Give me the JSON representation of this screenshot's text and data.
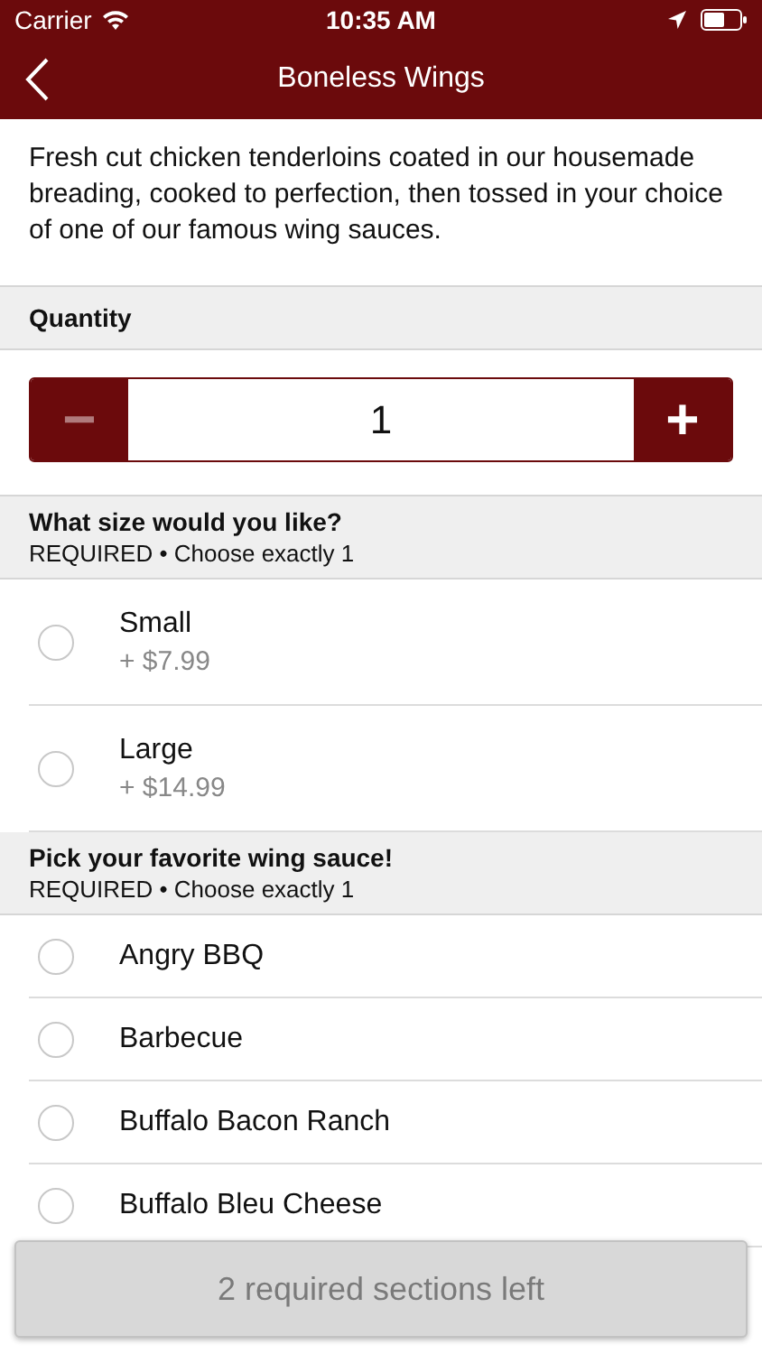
{
  "status_bar": {
    "carrier": "Carrier",
    "time": "10:35 AM"
  },
  "nav": {
    "title": "Boneless Wings"
  },
  "description": "Fresh cut chicken tenderloins coated in our housemade breading, cooked to perfection, then tossed in your choice of one of our famous wing sauces.",
  "quantity": {
    "title": "Quantity",
    "value": "1",
    "decrement": {
      "label": "−",
      "disabled": true
    },
    "increment": {
      "label": "+",
      "disabled": false
    }
  },
  "sections": [
    {
      "title": "What size would you like?",
      "subtitle": "REQUIRED • Choose exactly 1",
      "options": [
        {
          "label": "Small",
          "price": "+ $7.99",
          "selected": false
        },
        {
          "label": "Large",
          "price": "+ $14.99",
          "selected": false
        }
      ]
    },
    {
      "title": "Pick your favorite wing sauce!",
      "subtitle": "REQUIRED • Choose exactly 1",
      "options": [
        {
          "label": "Angry BBQ",
          "selected": false
        },
        {
          "label": "Barbecue",
          "selected": false
        },
        {
          "label": "Buffalo Bacon Ranch",
          "selected": false
        },
        {
          "label": "Buffalo Bleu Cheese",
          "selected": false
        }
      ]
    }
  ],
  "footer_button": {
    "label": "2 required sections left",
    "disabled": true
  }
}
